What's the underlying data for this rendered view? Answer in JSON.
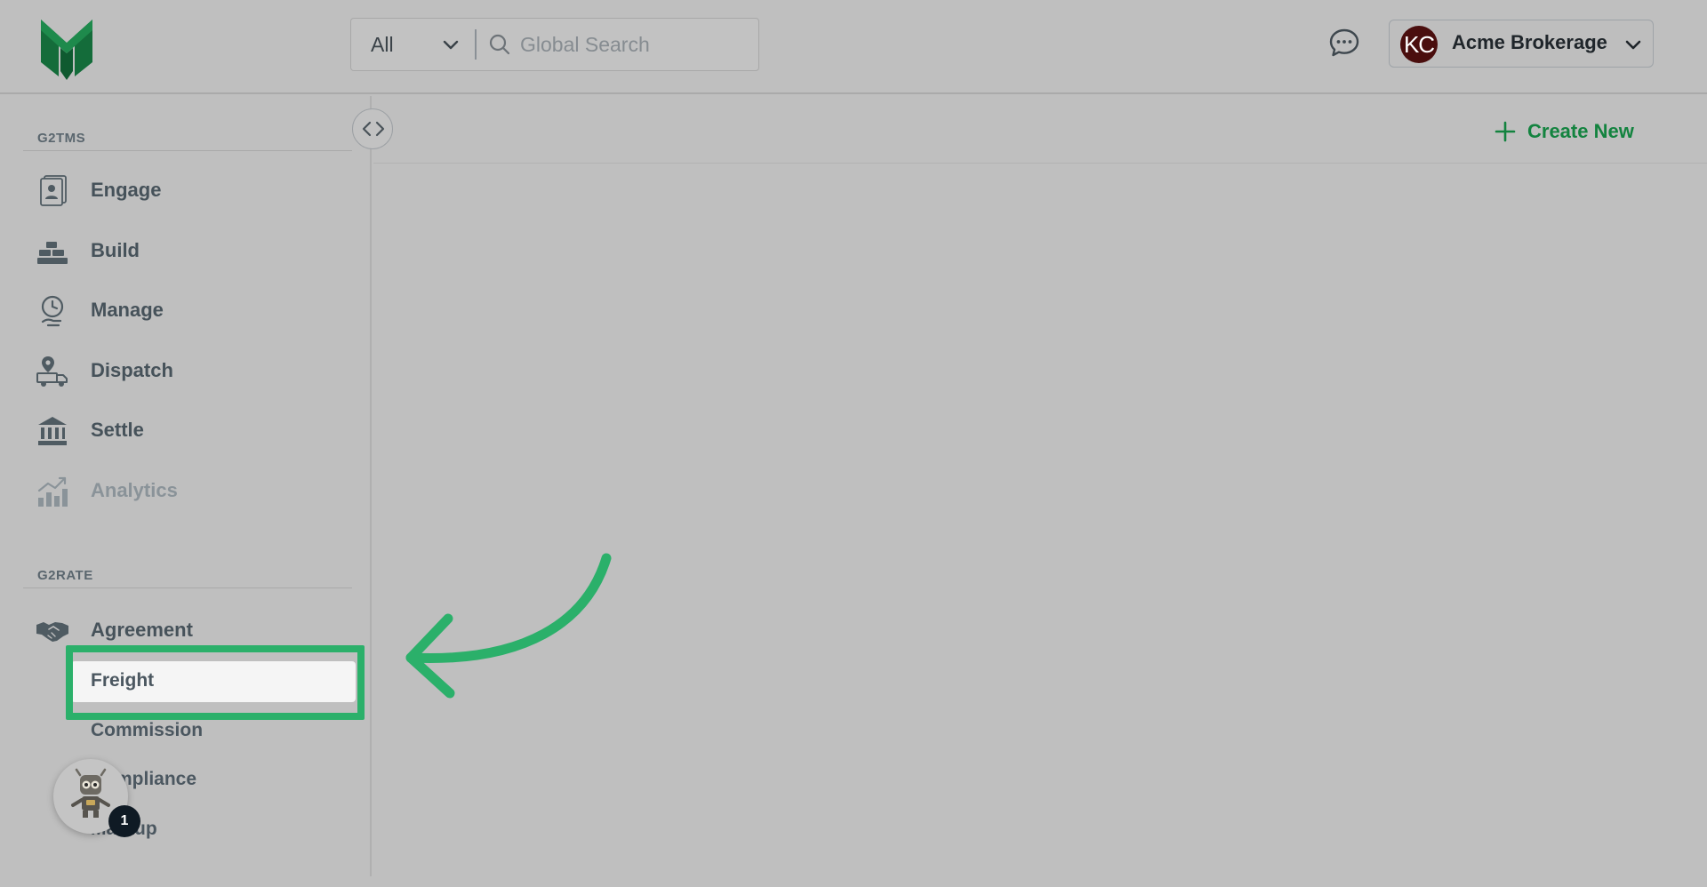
{
  "header": {
    "search_scope": "All",
    "search_placeholder": "Global Search",
    "account": {
      "avatar_initials": "KC",
      "name": "Acme Brokerage"
    }
  },
  "sidebar": {
    "sections": [
      {
        "label": "G2TMS",
        "items": [
          {
            "label": "Engage",
            "icon": "contacts-icon"
          },
          {
            "label": "Build",
            "icon": "bricks-icon"
          },
          {
            "label": "Manage",
            "icon": "clock-hand-icon"
          },
          {
            "label": "Dispatch",
            "icon": "truck-location-icon"
          },
          {
            "label": "Settle",
            "icon": "bank-icon"
          },
          {
            "label": "Analytics",
            "icon": "chart-trend-icon"
          }
        ]
      },
      {
        "label": "G2RATE",
        "items": [
          {
            "label": "Agreement",
            "icon": "handshake-icon"
          }
        ],
        "sub_items": [
          {
            "label": "Freight",
            "active": true
          },
          {
            "label": "Commission"
          },
          {
            "label": "Compliance"
          },
          {
            "label": "Markup"
          }
        ]
      }
    ]
  },
  "content": {
    "create_new_label": "Create New"
  },
  "bot": {
    "badge_count": "1"
  },
  "colors": {
    "accent_green": "#13833f",
    "highlight_green": "#2bb06a",
    "avatar_bg": "#4a0e0e"
  }
}
